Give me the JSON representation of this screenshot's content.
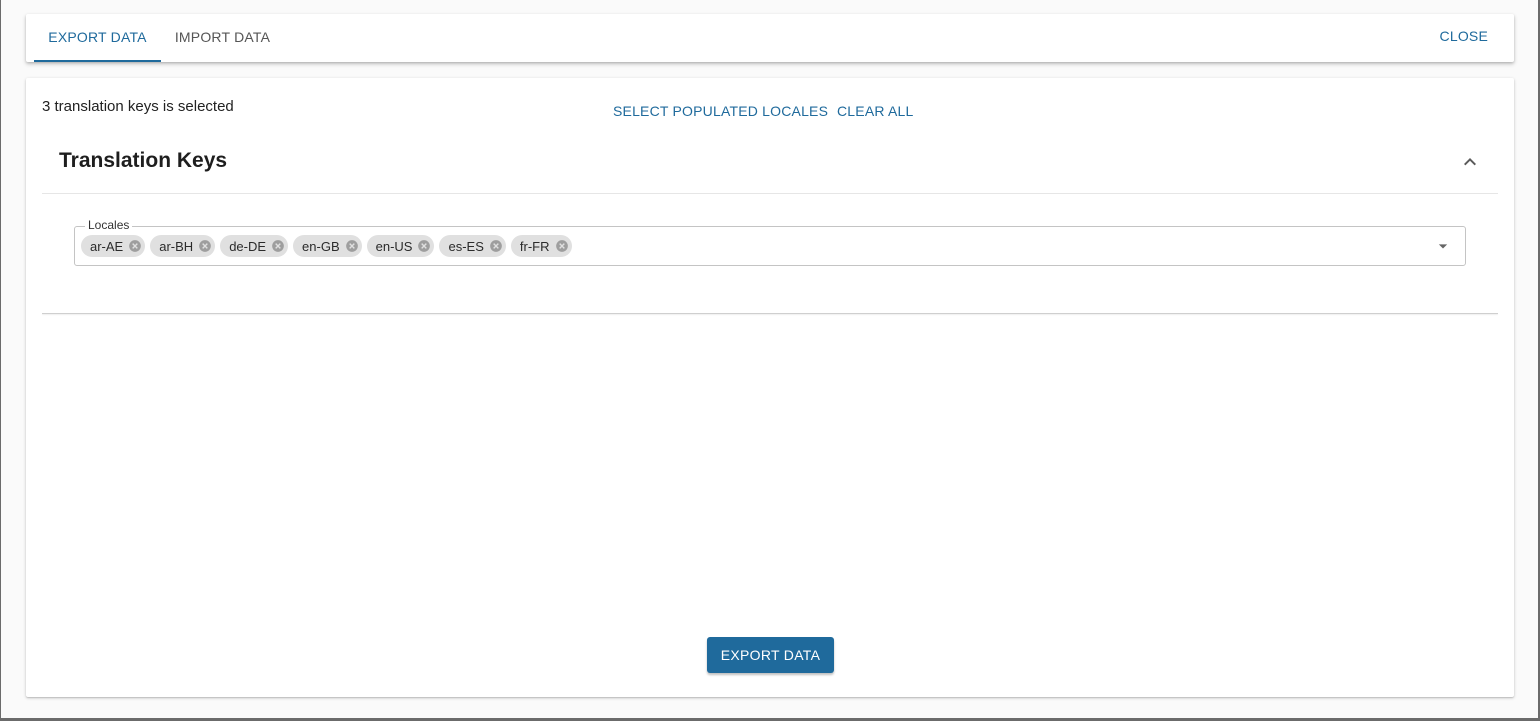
{
  "tabs": [
    {
      "label": "EXPORT DATA",
      "active": true
    },
    {
      "label": "IMPORT DATA",
      "active": false
    }
  ],
  "close_label": "CLOSE",
  "selection_status": "3 translation keys is selected",
  "actions": {
    "select_populated_label": "SELECT POPULATED LOCALES",
    "clear_all_label": "CLEAR ALL"
  },
  "section": {
    "title": "Translation Keys",
    "collapse_icon": "chevron-up-icon"
  },
  "locales": {
    "label": "Locales",
    "selected": [
      "ar-AE",
      "ar-BH",
      "de-DE",
      "en-GB",
      "en-US",
      "es-ES",
      "fr-FR"
    ],
    "remove_icon": "cancel-circle-icon",
    "dropdown_icon": "arrow-drop-down-icon"
  },
  "primary_action_label": "EXPORT DATA",
  "colors": {
    "accent": "#1f6a9c",
    "chip_bg": "#e0e0e0"
  }
}
